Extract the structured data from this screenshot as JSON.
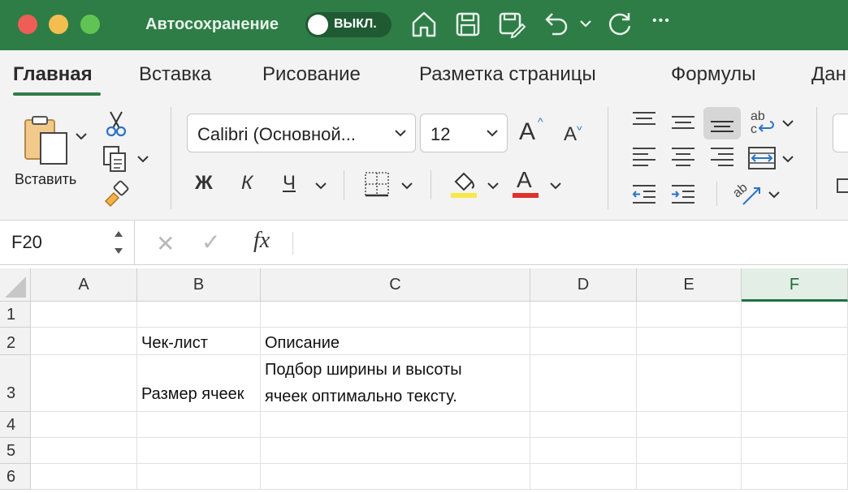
{
  "titlebar": {
    "autosave_label": "Автосохранение",
    "toggle_label": "ВЫКЛ.",
    "more_label": "•••"
  },
  "tabs": [
    {
      "label": "Главная",
      "active": true
    },
    {
      "label": "Вставка"
    },
    {
      "label": "Рисование"
    },
    {
      "label": "Разметка страницы"
    },
    {
      "label": "Формулы"
    },
    {
      "label": "Дан"
    }
  ],
  "ribbon": {
    "paste_label": "Вставить",
    "font_name": "Calibri (Основной...",
    "font_size": "12",
    "increase_font": "A",
    "decrease_font": "A",
    "bold": "Ж",
    "italic": "К",
    "underline": "Ч",
    "font_color_letter": "A",
    "wrap_text_label": "ab",
    "orientation_label": "ab",
    "fill_color": "#f7e84a",
    "font_color": "#e0312b",
    "active_align_bg": "#d6d6d6"
  },
  "formula_bar": {
    "name_box": "F20",
    "cancel": "✕",
    "enter": "✓",
    "fx": "fx",
    "content": ""
  },
  "sheet": {
    "columns": [
      "A",
      "B",
      "C",
      "D",
      "E",
      "F"
    ],
    "selected_column": "F",
    "rows": [
      {
        "num": "1",
        "cells": [
          "",
          "",
          "",
          "",
          "",
          ""
        ]
      },
      {
        "num": "2",
        "cells": [
          "",
          "Чек-лист",
          "Описание",
          "",
          "",
          ""
        ]
      },
      {
        "num": "3",
        "cells": [
          "",
          "Размер ячеек",
          "",
          "",
          "",
          ""
        ],
        "c_lines": [
          "Подбор ширины и высоты",
          "ячеек оптимально тексту."
        ]
      },
      {
        "num": "4",
        "cells": [
          "",
          "",
          "",
          "",
          "",
          ""
        ]
      },
      {
        "num": "5",
        "cells": [
          "",
          "",
          "",
          "",
          "",
          ""
        ]
      },
      {
        "num": "6",
        "cells": [
          "",
          "",
          "",
          "",
          "",
          ""
        ]
      }
    ]
  },
  "colors": {
    "titlebar_bg": "#2e7d46",
    "accent": "#1f7244"
  }
}
